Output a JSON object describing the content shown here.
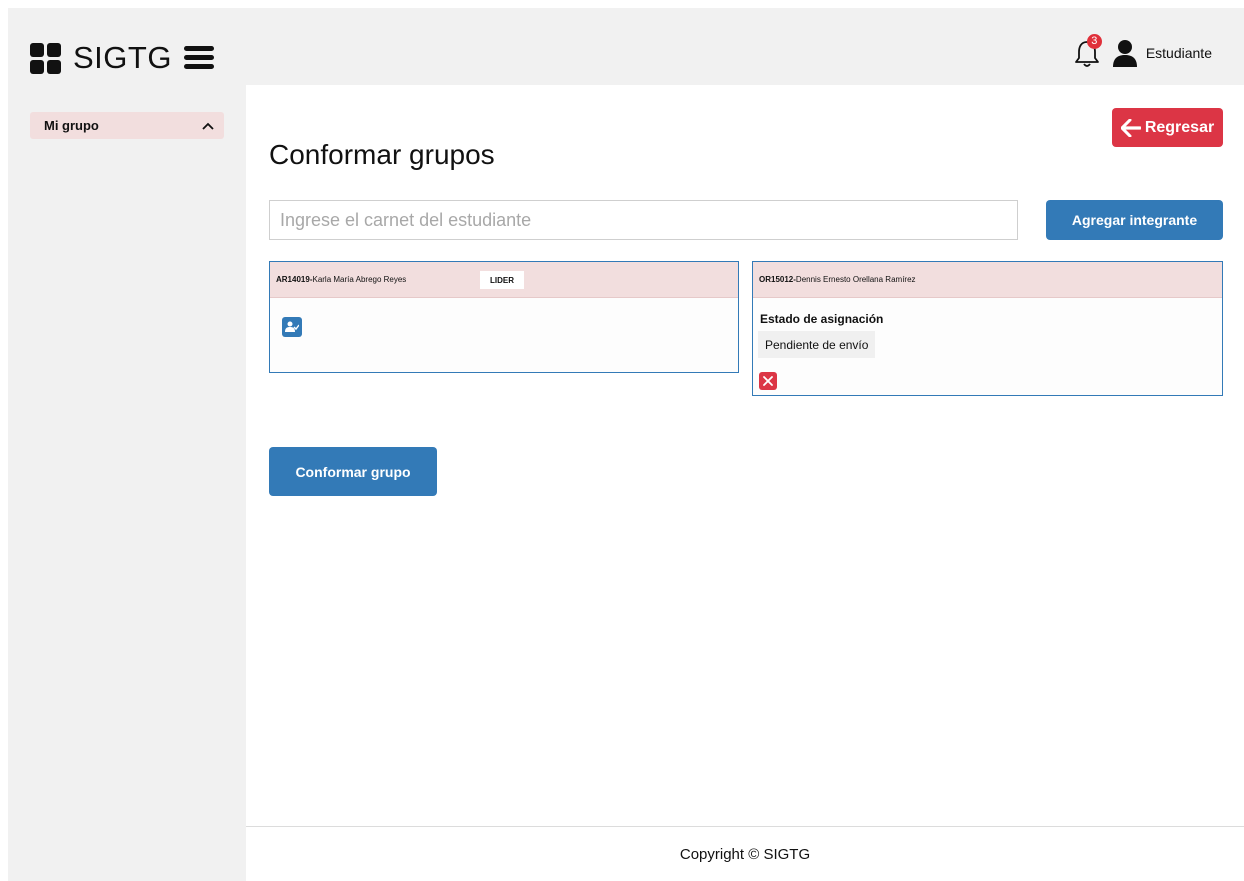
{
  "header": {
    "app_name": "SIGTG",
    "notification_count": "3",
    "user_role": "Estudiante"
  },
  "sidebar": {
    "items": [
      {
        "label": "Mi grupo",
        "icon": "chevron-up-icon"
      }
    ]
  },
  "main": {
    "back_button": "Regresar",
    "title": "Conformar grupos",
    "carnet_input": {
      "placeholder": "Ingrese el carnet del estudiante",
      "value": ""
    },
    "add_button": "Agregar integrante",
    "members": [
      {
        "carnet": "AR14019",
        "separator": " - ",
        "name": "Karla María Abrego Reyes",
        "tag": "LIDER"
      },
      {
        "carnet": "OR15012",
        "separator": " - ",
        "name": "Dennis Ernesto Orellana Ramírez",
        "status_title": "Estado de asignación",
        "status_value": "Pendiente de envío"
      }
    ],
    "submit_button": "Conformar grupo"
  },
  "footer": {
    "text": "Copyright © SIGTG"
  },
  "colors": {
    "primary": "#337ab7",
    "danger": "#dc3545",
    "highlight": "#f2dede",
    "background": "#f1f1f1"
  }
}
